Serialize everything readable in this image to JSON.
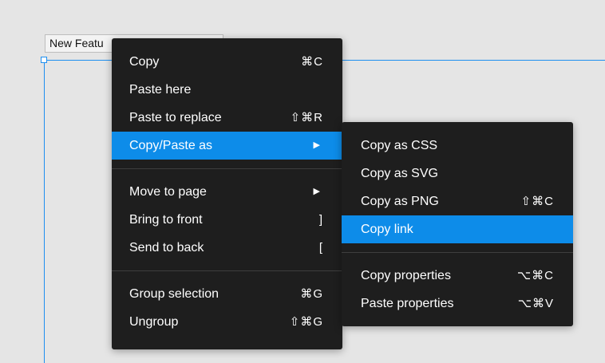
{
  "frame": {
    "label": "New Featu"
  },
  "main_menu": {
    "groups": [
      [
        {
          "label": "Copy",
          "shortcut": "⌘C"
        },
        {
          "label": "Paste here",
          "shortcut": ""
        },
        {
          "label": "Paste to replace",
          "shortcut": "⇧⌘R"
        },
        {
          "label": "Copy/Paste as",
          "shortcut": "",
          "has_submenu": true,
          "active": true
        }
      ],
      [
        {
          "label": "Move to page",
          "shortcut": "",
          "has_submenu": true
        },
        {
          "label": "Bring to front",
          "shortcut": "]"
        },
        {
          "label": "Send to back",
          "shortcut": "["
        }
      ],
      [
        {
          "label": "Group selection",
          "shortcut": "⌘G"
        },
        {
          "label": "Ungroup",
          "shortcut": "⇧⌘G"
        }
      ]
    ]
  },
  "sub_menu": {
    "groups": [
      [
        {
          "label": "Copy as CSS",
          "shortcut": ""
        },
        {
          "label": "Copy as SVG",
          "shortcut": ""
        },
        {
          "label": "Copy as PNG",
          "shortcut": "⇧⌘C"
        },
        {
          "label": "Copy link",
          "shortcut": "",
          "active": true
        }
      ],
      [
        {
          "label": "Copy properties",
          "shortcut": "⌥⌘C"
        },
        {
          "label": "Paste properties",
          "shortcut": "⌥⌘V"
        }
      ]
    ]
  },
  "icons": {
    "submenu_arrow": "triangle-right-icon"
  },
  "colors": {
    "menu_bg": "#1e1e1e",
    "highlight": "#0d8ce9",
    "selection": "#1e8ff0"
  }
}
